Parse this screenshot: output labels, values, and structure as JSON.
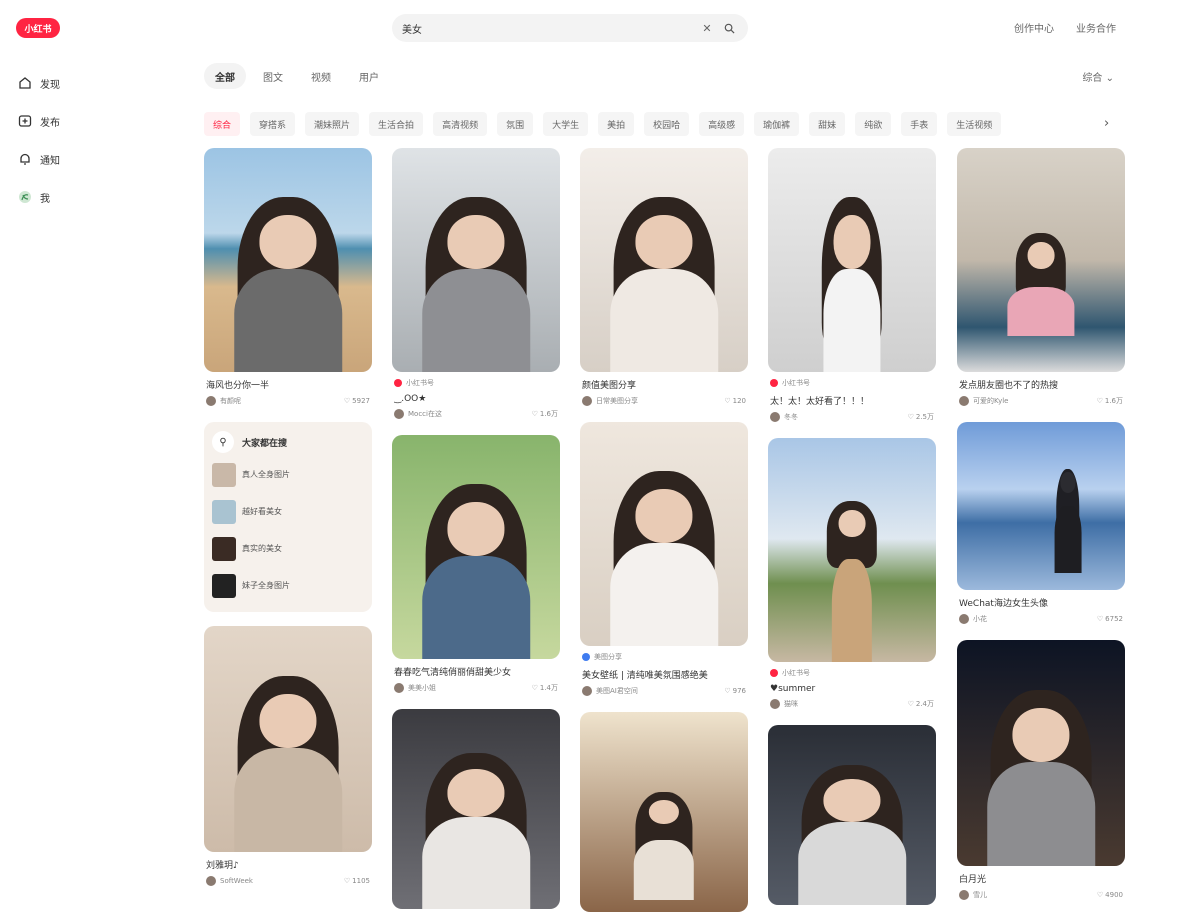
{
  "app": {
    "logo": "小红书"
  },
  "nav": [
    {
      "label": "发现",
      "icon": "home-icon"
    },
    {
      "label": "发布",
      "icon": "publish-icon"
    },
    {
      "label": "通知",
      "icon": "bell-icon"
    },
    {
      "label": "我",
      "icon": "avatar-icon"
    }
  ],
  "search": {
    "value": "美女",
    "clear_icon": "close-icon",
    "submit_icon": "search-icon"
  },
  "header": {
    "creator": "创作中心",
    "business": "业务合作"
  },
  "tabs": [
    "全部",
    "图文",
    "视频",
    "用户"
  ],
  "sort": "综合 ⌄",
  "chips": [
    "综合",
    "穿搭系",
    "潮妹照片",
    "生活合拍",
    "高清视频",
    "氛围",
    "大学生",
    "美拍",
    "校园哈",
    "高级感",
    "瑜伽裤",
    "甜妹",
    "纯欲",
    "手表",
    "生活视频"
  ],
  "suggest": {
    "title": "大家都在搜",
    "items": [
      "真人全身图片",
      "越好看美女",
      "真实的美女",
      "妹子全身图片"
    ]
  },
  "cards": [
    {
      "title": "海风也分你一半",
      "author": "有颜呢",
      "likes": "5927"
    },
    {
      "tag": "小红书号",
      "title": "‿.OO★",
      "author": "Mocci在这",
      "likes": "1.6万"
    },
    {
      "title": "颜值美图分享",
      "author": "日常美图分享",
      "likes": "120"
    },
    {
      "tag": "小红书号",
      "title": "太！太！太好看了！！！",
      "author": "冬冬",
      "likes": "2.5万"
    },
    {
      "title": "发点朋友圈也不了的热搜",
      "author": "可爱的Kyle",
      "likes": "1.6万"
    },
    {
      "title": "春春吃气清纯俏丽俏甜美少女",
      "author": "美美小姐",
      "likes": "1.4万"
    },
    {
      "tag": "美图分享",
      "title": "美女壁纸 | 清纯唯美氛围感绝美",
      "author": "美图AI君空间",
      "likes": "976"
    },
    {
      "tag": "小红书号",
      "title": "♥summer",
      "author": "猫咪",
      "likes": "2.4万"
    },
    {
      "title": "WeChat海边女生头像",
      "author": "小花",
      "likes": "6752"
    },
    {
      "title": "刘雅玥♪",
      "author": "SoftWeek",
      "likes": "1105"
    },
    {
      "title": "白月光",
      "author": "雪儿",
      "likes": "4900"
    }
  ],
  "colors": {
    "brand": "#ff2442"
  }
}
